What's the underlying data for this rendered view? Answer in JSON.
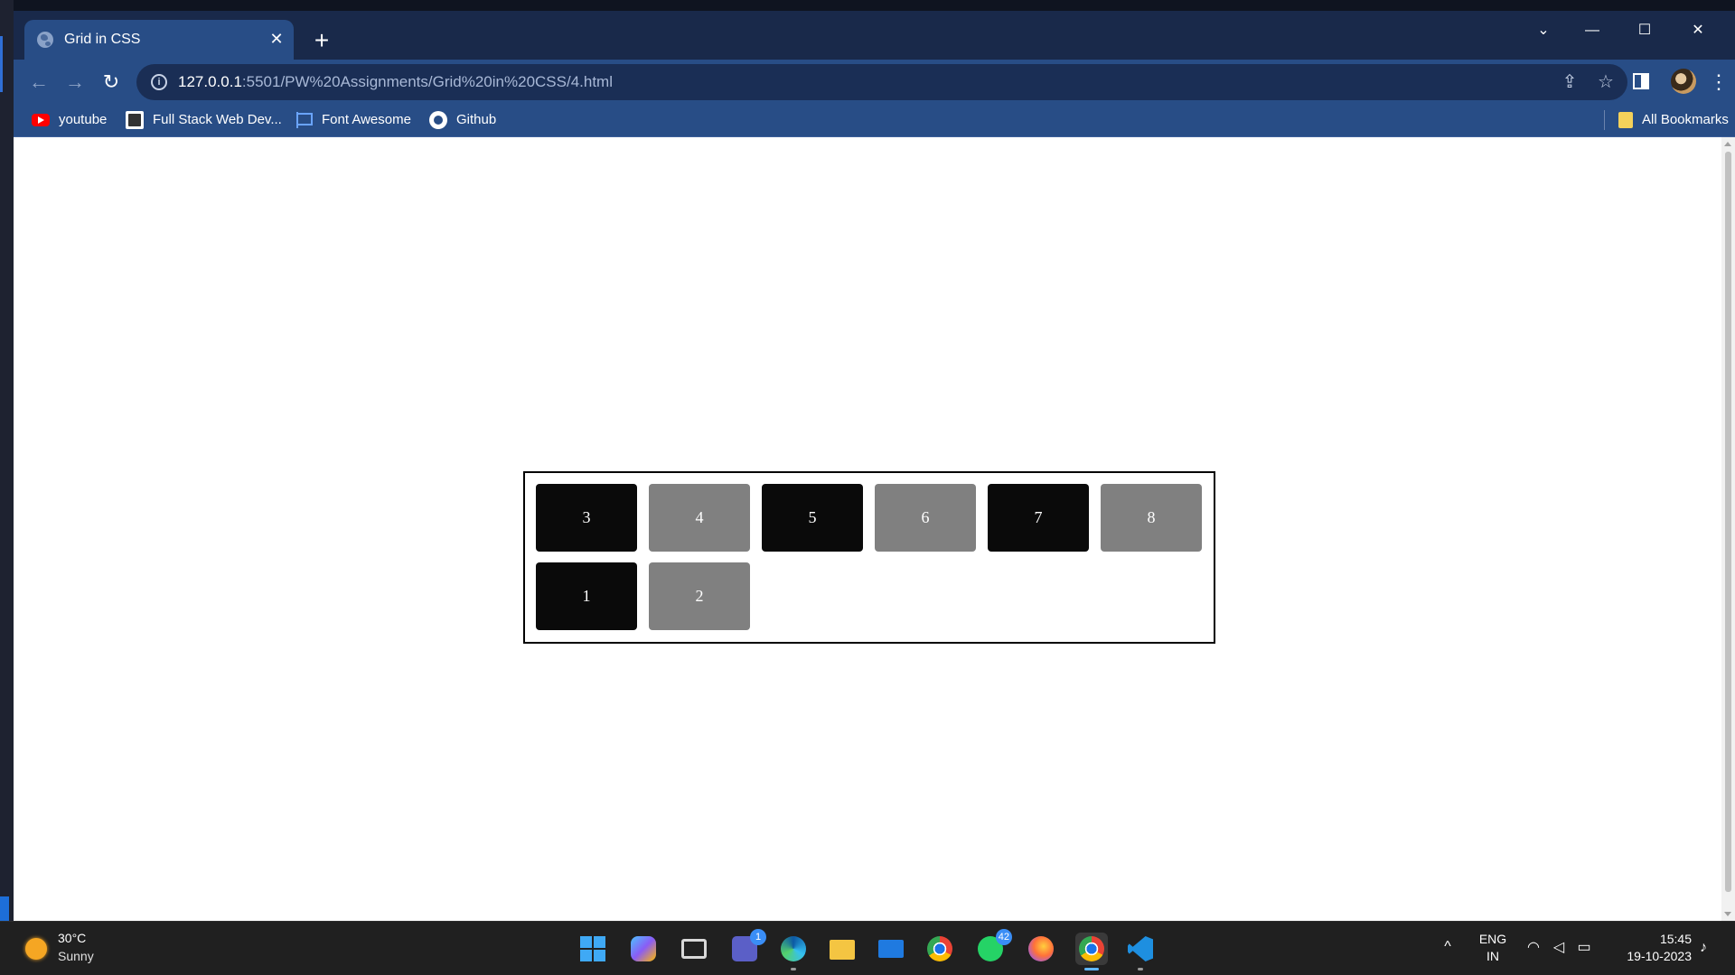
{
  "browser": {
    "tab": {
      "title": "Grid in CSS",
      "close_glyph": "✕"
    },
    "new_tab_glyph": "+",
    "window_controls": {
      "tab_search": "⌄",
      "minimize": "—",
      "maximize": "☐",
      "close": "✕"
    },
    "toolbar": {
      "back": "←",
      "forward": "→",
      "reload": "↻",
      "url_host": "127.0.0.1",
      "url_rest": ":5501/PW%20Assignments/Grid%20in%20CSS/4.html",
      "share_glyph": "⇪",
      "star_glyph": "☆",
      "menu_glyph": "⋮"
    },
    "bookmarks": [
      {
        "label": "youtube",
        "icon": "youtube-icon"
      },
      {
        "label": "Full Stack Web Dev...",
        "icon": "fullstack-icon"
      },
      {
        "label": "Font Awesome",
        "icon": "flag-icon"
      },
      {
        "label": "Github",
        "icon": "github-icon"
      }
    ],
    "all_bookmarks": "All Bookmarks"
  },
  "page": {
    "grid_items": [
      {
        "label": "3",
        "color": "#0a0a0a"
      },
      {
        "label": "4",
        "color": "#808080"
      },
      {
        "label": "5",
        "color": "#0a0a0a"
      },
      {
        "label": "6",
        "color": "#808080"
      },
      {
        "label": "7",
        "color": "#0a0a0a"
      },
      {
        "label": "8",
        "color": "#808080"
      },
      {
        "label": "1",
        "color": "#0a0a0a"
      },
      {
        "label": "2",
        "color": "#808080"
      }
    ]
  },
  "taskbar": {
    "weather": {
      "temp": "30°C",
      "desc": "Sunny"
    },
    "apps": [
      {
        "name": "start-icon"
      },
      {
        "name": "copilot-pre-icon"
      },
      {
        "name": "task-view-icon"
      },
      {
        "name": "teams-icon",
        "badge": "1"
      },
      {
        "name": "edge-icon"
      },
      {
        "name": "file-explorer-icon"
      },
      {
        "name": "mail-icon"
      },
      {
        "name": "chrome-icon"
      },
      {
        "name": "whatsapp-icon",
        "badge": "42"
      },
      {
        "name": "firefox-icon"
      },
      {
        "name": "chrome-profile-icon"
      },
      {
        "name": "vscode-icon"
      }
    ],
    "tray": {
      "chevron": "^",
      "lang_line1": "ENG",
      "lang_line2": "IN",
      "time": "15:45",
      "date": "19-10-2023"
    }
  }
}
